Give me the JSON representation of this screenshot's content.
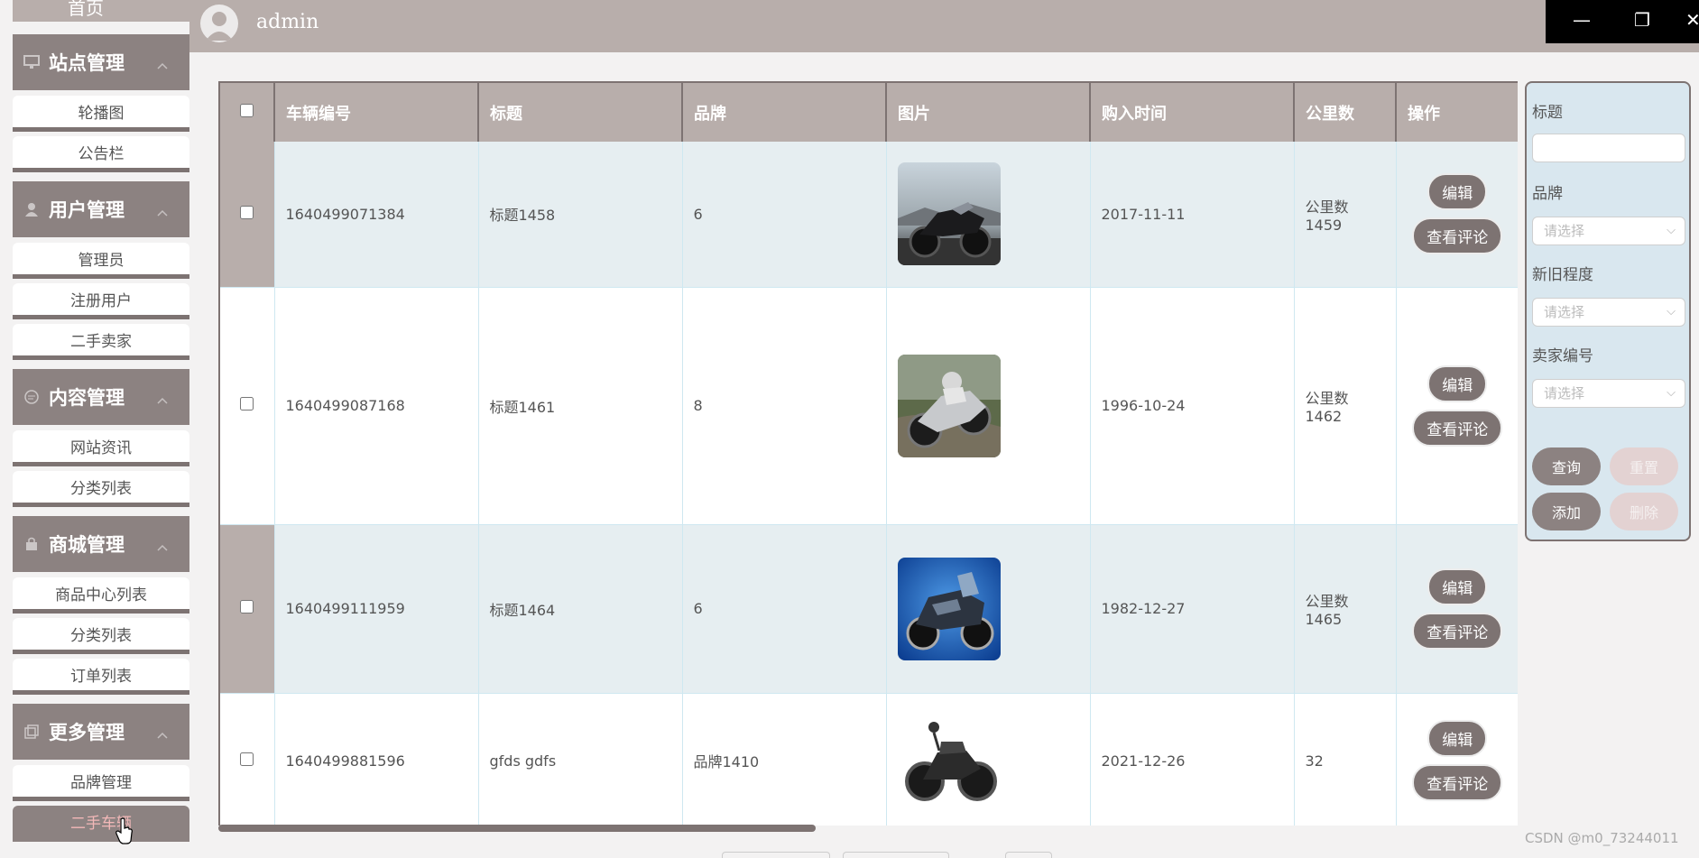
{
  "sidebar": {
    "home": "首页",
    "groups": [
      {
        "label": "站点管理",
        "icon": "monitor-icon",
        "items": [
          "轮播图",
          "公告栏"
        ]
      },
      {
        "label": "用户管理",
        "icon": "user-icon",
        "items": [
          "管理员",
          "注册用户",
          "二手卖家"
        ]
      },
      {
        "label": "内容管理",
        "icon": "chat-icon",
        "items": [
          "网站资讯",
          "分类列表"
        ]
      },
      {
        "label": "商城管理",
        "icon": "bag-icon",
        "items": [
          "商品中心列表",
          "分类列表",
          "订单列表"
        ]
      },
      {
        "label": "更多管理",
        "icon": "copy-icon",
        "items": [
          "品牌管理",
          "二手车辆"
        ]
      }
    ]
  },
  "topbar": {
    "username": "admin"
  },
  "window_controls": {
    "minimize": "—",
    "restore": "❐",
    "close": "✕"
  },
  "table": {
    "headers": [
      "车辆编号",
      "标题",
      "品牌",
      "图片",
      "购入时间",
      "公里数",
      "操作"
    ],
    "edit_label": "编辑",
    "comments_label": "查看评论",
    "rows": [
      {
        "id": "1640499071384",
        "title": "标题1458",
        "brand": "6",
        "image": "sport-motorcycle",
        "date": "2017-11-11",
        "km": "公里数1459"
      },
      {
        "id": "1640499087168",
        "title": "标题1461",
        "brand": "8",
        "image": "touring-motorcycle",
        "date": "1996-10-24",
        "km": "公里数1462"
      },
      {
        "id": "1640499111959",
        "title": "标题1464",
        "brand": "6",
        "image": "blue-motorcycle",
        "date": "1982-12-27",
        "km": "公里数1465"
      },
      {
        "id": "1640499881596",
        "title": "gfds gdfs",
        "brand": "品牌1410",
        "image": "black-cruiser",
        "date": "2021-12-26",
        "km": "32"
      }
    ]
  },
  "filter": {
    "title_label": "标题",
    "title_value": "",
    "brand_label": "品牌",
    "brand_placeholder": "请选择",
    "condition_label": "新旧程度",
    "condition_placeholder": "请选择",
    "seller_label": "卖家编号",
    "seller_placeholder": "请选择",
    "query": "查询",
    "reset": "重置",
    "add": "添加",
    "delete": "删除"
  },
  "watermark": "CSDN @m0_73244011",
  "colors": {
    "primary": "#8c8281",
    "header": "#b8aeab",
    "accent_active": "#f2b8b8",
    "row_alt": "#e6eef1"
  }
}
